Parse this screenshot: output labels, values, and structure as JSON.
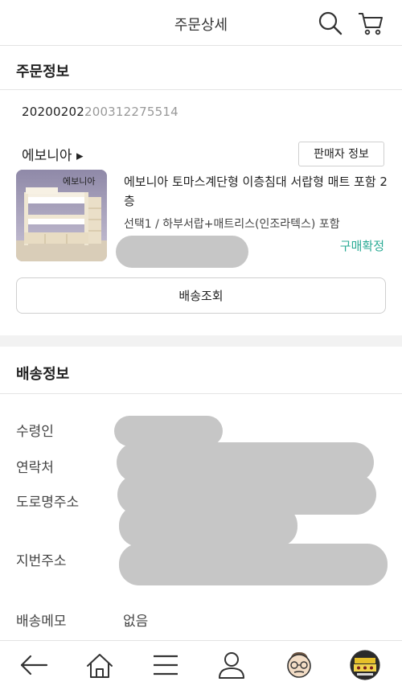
{
  "header": {
    "title": "주문상세",
    "icons": [
      "search-icon",
      "cart-icon"
    ]
  },
  "order": {
    "section_title": "주문정보",
    "order_number_prefix": "20200202",
    "order_number_suffix": "200312275514",
    "seller_name": "에보니아 ▸",
    "seller_info_label": "판매자 정보",
    "product_name": "에보니아 토마스계단형 이층침대 서랍형 매트 포함 2층",
    "product_option": "선택1 / 하부서랍+매트리스(인조라텍스) 포함",
    "product_thumb_text": "에보니아",
    "status": "구매확정",
    "status_color": "#2bab95",
    "track_button_label": "배송조회"
  },
  "shipping": {
    "section_title": "배송정보",
    "recipient_label": "수령인",
    "contact_label": "연락처",
    "road_address_label": "도로명주소",
    "lot_address_label": "지번주소",
    "memo_label": "배송메모",
    "memo_value": "없음"
  },
  "bottom_nav": {
    "icons": [
      "back-arrow-icon",
      "home-icon",
      "menu-icon",
      "profile-icon",
      "character-face-icon",
      "promo-badge-icon"
    ]
  }
}
